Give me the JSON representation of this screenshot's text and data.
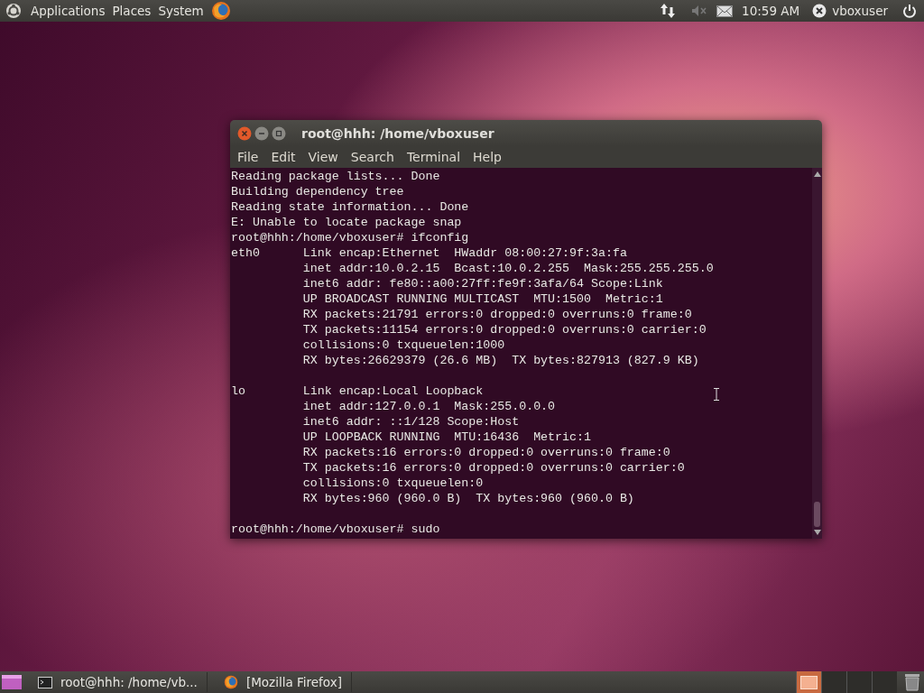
{
  "top_panel": {
    "menus": [
      "Applications",
      "Places",
      "System"
    ],
    "clock": "10:59 AM",
    "user": "vboxuser"
  },
  "terminal": {
    "title": "root@hhh: /home/vboxuser",
    "menu": [
      "File",
      "Edit",
      "View",
      "Search",
      "Terminal",
      "Help"
    ],
    "blocks": [
      [
        "Reading package lists... Done",
        "Building dependency tree",
        "Reading state information... Done",
        "E: Unable to locate package snap",
        "root@hhh:/home/vboxuser# ifconfig",
        "eth0      Link encap:Ethernet  HWaddr 08:00:27:9f:3a:fa",
        "          inet addr:10.0.2.15  Bcast:10.0.2.255  Mask:255.255.255.0",
        "          inet6 addr: fe80::a00:27ff:fe9f:3afa/64 Scope:Link",
        "          UP BROADCAST RUNNING MULTICAST  MTU:1500  Metric:1",
        "          RX packets:21791 errors:0 dropped:0 overruns:0 frame:0",
        "          TX packets:11154 errors:0 dropped:0 overruns:0 carrier:0",
        "          collisions:0 txqueuelen:1000",
        "          RX bytes:26629379 (26.6 MB)  TX bytes:827913 (827.9 KB)"
      ],
      [
        "lo        Link encap:Local Loopback",
        "          inet addr:127.0.0.1  Mask:255.0.0.0",
        "          inet6 addr: ::1/128 Scope:Host",
        "          UP LOOPBACK RUNNING  MTU:16436  Metric:1",
        "          RX packets:16 errors:0 dropped:0 overruns:0 frame:0",
        "          TX packets:16 errors:0 dropped:0 overruns:0 carrier:0",
        "          collisions:0 txqueuelen:0",
        "          RX bytes:960 (960.0 B)  TX bytes:960 (960.0 B)"
      ],
      [
        "root@hhh:/home/vboxuser# sudo"
      ]
    ]
  },
  "bottom_panel": {
    "tasks": [
      {
        "kind": "terminal",
        "label": "root@hhh: /home/vb..."
      },
      {
        "kind": "browser",
        "label": "[Mozilla Firefox]"
      }
    ],
    "workspaces": [
      {
        "selected": true
      },
      {
        "selected": false
      },
      {
        "selected": false
      },
      {
        "selected": false
      }
    ]
  }
}
